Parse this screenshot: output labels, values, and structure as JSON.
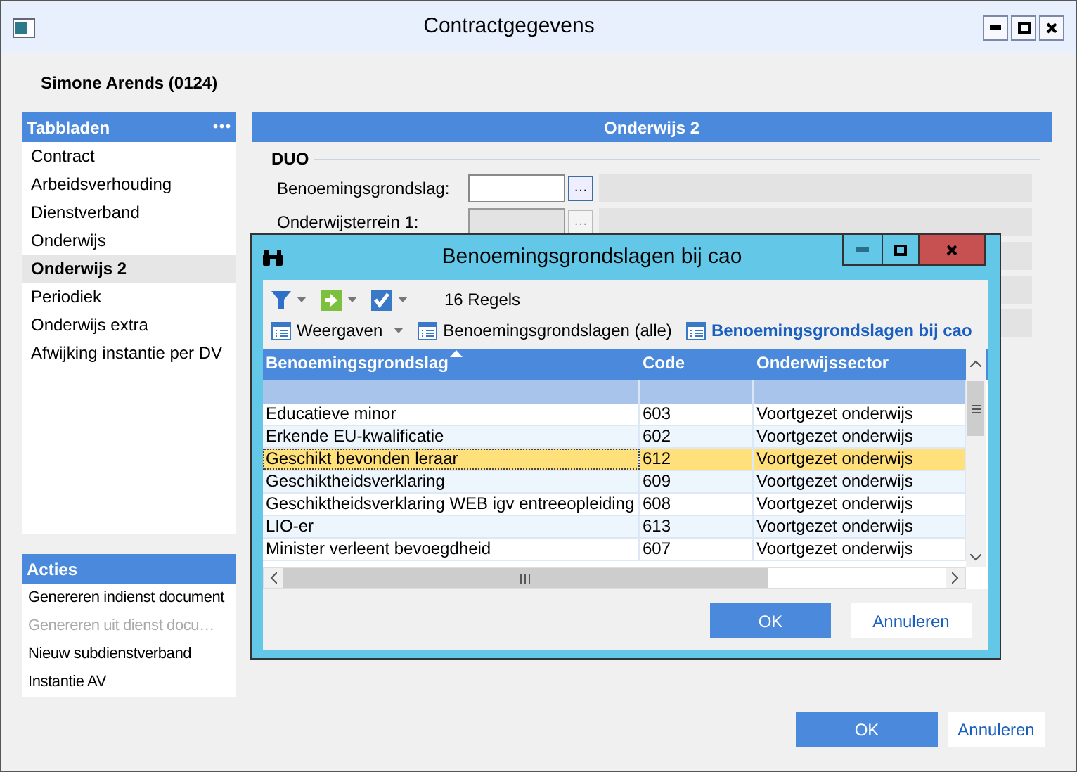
{
  "window": {
    "title": "Contractgegevens"
  },
  "employee": "Simone Arends (0124)",
  "tabs_panel": {
    "title": "Tabbladen",
    "menu": "•••",
    "items": [
      {
        "label": "Contract",
        "selected": false
      },
      {
        "label": "Arbeidsverhouding",
        "selected": false
      },
      {
        "label": "Dienstverband",
        "selected": false
      },
      {
        "label": "Onderwijs",
        "selected": false
      },
      {
        "label": "Onderwijs 2",
        "selected": true
      },
      {
        "label": "Periodiek",
        "selected": false
      },
      {
        "label": "Onderwijs extra",
        "selected": false
      },
      {
        "label": "Afwijking instantie per DV",
        "selected": false
      }
    ]
  },
  "actions_panel": {
    "title": "Acties",
    "items": [
      {
        "label": "Genereren indienst document",
        "disabled": false
      },
      {
        "label": "Genereren uit dienst docu…",
        "disabled": true
      },
      {
        "label": "Nieuw subdienstverband",
        "disabled": false
      },
      {
        "label": "Instantie AV",
        "disabled": false
      }
    ]
  },
  "content": {
    "title": "Onderwijs 2",
    "group": "DUO",
    "fields": [
      {
        "label": "Benoemingsgrondslag:",
        "browse": "…",
        "disabled": false
      },
      {
        "label": "Onderwijsterrein 1:",
        "browse": "…",
        "disabled": true
      }
    ]
  },
  "dialog": {
    "title": "Benoemingsgrondslagen bij cao",
    "count": "16 Regels",
    "views": [
      {
        "label": "Weergaven",
        "kind": "menu",
        "selected": false
      },
      {
        "label": "Benoemingsgrondslagen (alle)",
        "kind": "view",
        "selected": false
      },
      {
        "label": "Benoemingsgrondslagen bij cao",
        "kind": "view",
        "selected": true
      }
    ],
    "columns": [
      {
        "label": "Benoemingsgrondslag",
        "sorted": true
      },
      {
        "label": "Code",
        "sorted": false
      },
      {
        "label": "Onderwijssector",
        "sorted": false
      }
    ],
    "rows": [
      {
        "cells": [
          "Educatieve minor",
          "603",
          "Voortgezet onderwijs"
        ],
        "selected": false
      },
      {
        "cells": [
          "Erkende EU-kwalificatie",
          "602",
          "Voortgezet onderwijs"
        ],
        "selected": false
      },
      {
        "cells": [
          "Geschikt bevonden leraar",
          "612",
          "Voortgezet onderwijs"
        ],
        "selected": true
      },
      {
        "cells": [
          "Geschiktheidsverklaring",
          "609",
          "Voortgezet onderwijs"
        ],
        "selected": false
      },
      {
        "cells": [
          "Geschiktheidsverklaring WEB igv entreeopleiding",
          "608",
          "Voortgezet onderwijs"
        ],
        "selected": false
      },
      {
        "cells": [
          "LIO-er",
          "613",
          "Voortgezet onderwijs"
        ],
        "selected": false
      },
      {
        "cells": [
          "Minister verleent bevoegdheid",
          "607",
          "Voortgezet onderwijs"
        ],
        "selected": false
      }
    ],
    "buttons": [
      "OK",
      "Annuleren"
    ]
  },
  "buttons": [
    "OK",
    "Annuleren"
  ]
}
